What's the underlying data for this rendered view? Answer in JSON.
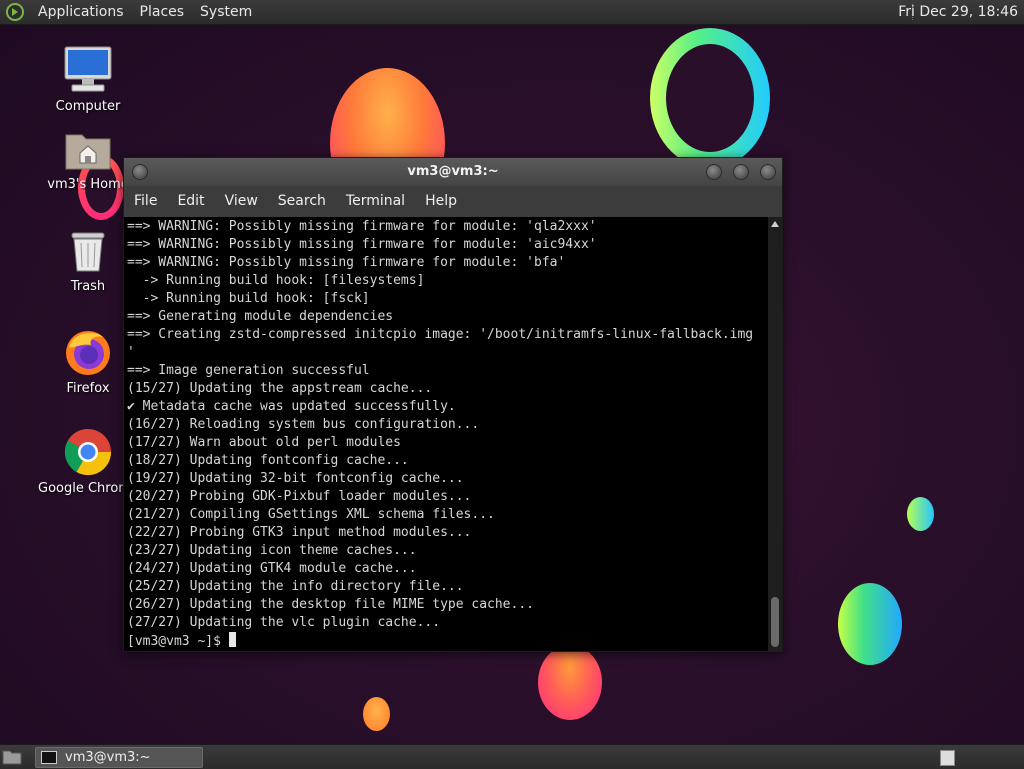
{
  "top_panel": {
    "menus": [
      "Applications",
      "Places",
      "System"
    ],
    "clock": "Fri Dec 29, 18:46"
  },
  "desktop_icons": [
    {
      "label": "Computer",
      "icon": "computer-icon"
    },
    {
      "label": "vm3's Home",
      "icon": "home-folder-icon"
    },
    {
      "label": "Trash",
      "icon": "trash-icon"
    },
    {
      "label": "Firefox",
      "icon": "firefox-icon"
    },
    {
      "label": "Google Chrome",
      "icon": "chrome-icon"
    }
  ],
  "terminal": {
    "title": "vm3@vm3:~",
    "menu": [
      "File",
      "Edit",
      "View",
      "Search",
      "Terminal",
      "Help"
    ],
    "lines": [
      "==> WARNING: Possibly missing firmware for module: 'qla2xxx'",
      "==> WARNING: Possibly missing firmware for module: 'aic94xx'",
      "==> WARNING: Possibly missing firmware for module: 'bfa'",
      "  -> Running build hook: [filesystems]",
      "  -> Running build hook: [fsck]",
      "==> Generating module dependencies",
      "==> Creating zstd-compressed initcpio image: '/boot/initramfs-linux-fallback.img",
      "'",
      "==> Image generation successful",
      "(15/27) Updating the appstream cache...",
      "✔ Metadata cache was updated successfully.",
      "(16/27) Reloading system bus configuration...",
      "(17/27) Warn about old perl modules",
      "(18/27) Updating fontconfig cache...",
      "(19/27) Updating 32-bit fontconfig cache...",
      "(20/27) Probing GDK-Pixbuf loader modules...",
      "(21/27) Compiling GSettings XML schema files...",
      "(22/27) Probing GTK3 input method modules...",
      "(23/27) Updating icon theme caches...",
      "(24/27) Updating GTK4 module cache...",
      "(25/27) Updating the info directory file...",
      "(26/27) Updating the desktop file MIME type cache...",
      "(27/27) Updating the vlc plugin cache..."
    ],
    "prompt": "[vm3@vm3 ~]$ "
  },
  "bottom_panel": {
    "task_label": "vm3@vm3:~"
  }
}
